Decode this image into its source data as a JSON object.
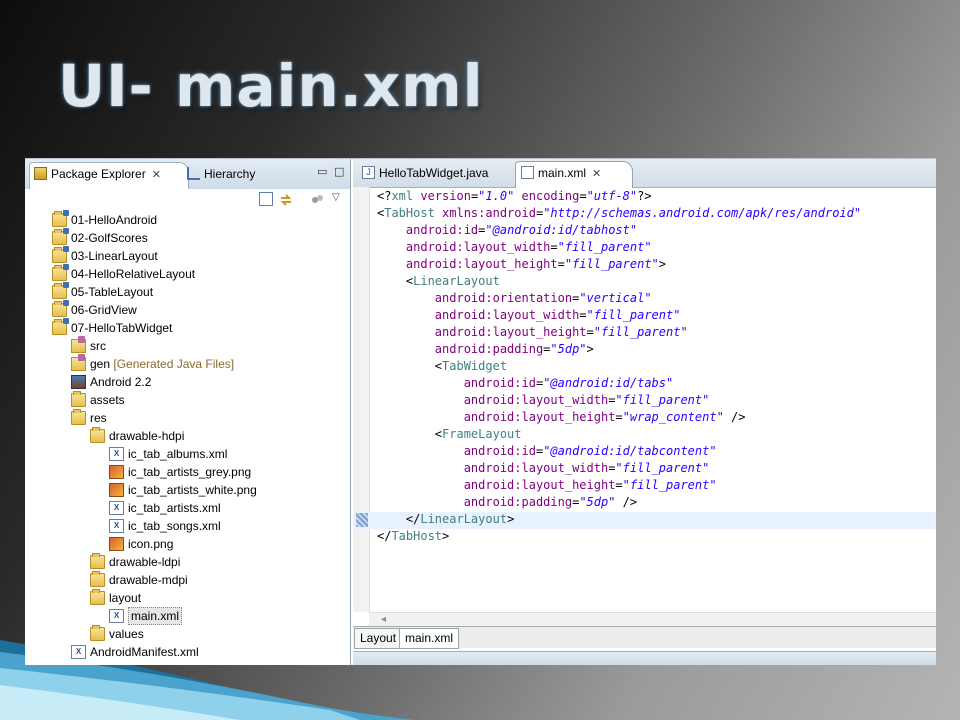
{
  "slide": {
    "title": "UI- main.xml"
  },
  "left_pane": {
    "tabs": [
      {
        "label": "Package Explorer",
        "icon": "package-explorer-icon"
      },
      {
        "label": "Hierarchy",
        "icon": "hierarchy-icon"
      }
    ],
    "close_glyph": "✕",
    "min_glyph": "▭",
    "max_glyph": "□"
  },
  "tree": [
    {
      "label": "01-HelloAndroid",
      "icon": "project-folder-icon",
      "depth": 1
    },
    {
      "label": "02-GolfScores",
      "icon": "project-folder-icon",
      "depth": 1
    },
    {
      "label": "03-LinearLayout",
      "icon": "project-folder-icon",
      "depth": 1
    },
    {
      "label": "04-HelloRelativeLayout",
      "icon": "project-folder-icon",
      "depth": 1
    },
    {
      "label": "05-TableLayout",
      "icon": "project-folder-icon",
      "depth": 1
    },
    {
      "label": "06-GridView",
      "icon": "project-folder-icon",
      "depth": 1
    },
    {
      "label": "07-HelloTabWidget",
      "icon": "project-folder-icon",
      "depth": 1
    },
    {
      "label": "src",
      "icon": "source-folder-icon",
      "depth": 2
    },
    {
      "label": "gen",
      "decoration": "[Generated Java Files]",
      "icon": "source-folder-icon",
      "depth": 2
    },
    {
      "label": "Android 2.2",
      "icon": "android-library-icon",
      "depth": 2
    },
    {
      "label": "assets",
      "icon": "folder-icon",
      "depth": 2
    },
    {
      "label": "res",
      "icon": "folder-icon",
      "depth": 2
    },
    {
      "label": "drawable-hdpi",
      "icon": "folder-icon",
      "depth": 3
    },
    {
      "label": "ic_tab_albums.xml",
      "icon": "xml-file-icon",
      "depth": 4
    },
    {
      "label": "ic_tab_artists_grey.png",
      "icon": "png-file-icon",
      "depth": 4
    },
    {
      "label": "ic_tab_artists_white.png",
      "icon": "png-file-icon",
      "depth": 4
    },
    {
      "label": "ic_tab_artists.xml",
      "icon": "xml-file-icon",
      "depth": 4
    },
    {
      "label": "ic_tab_songs.xml",
      "icon": "xml-file-icon",
      "depth": 4
    },
    {
      "label": "icon.png",
      "icon": "png-file-icon",
      "depth": 4
    },
    {
      "label": "drawable-ldpi",
      "icon": "folder-icon",
      "depth": 3
    },
    {
      "label": "drawable-mdpi",
      "icon": "folder-icon",
      "depth": 3
    },
    {
      "label": "layout",
      "icon": "folder-icon",
      "depth": 3
    },
    {
      "label": "main.xml",
      "icon": "xml-file-icon",
      "depth": 4,
      "selected": true
    },
    {
      "label": "values",
      "icon": "folder-icon",
      "depth": 3
    },
    {
      "label": "AndroidManifest.xml",
      "icon": "manifest-file-icon",
      "depth": 2
    }
  ],
  "editor": {
    "tabs": [
      {
        "label": "HelloTabWidget.java",
        "icon": "java-file-icon"
      },
      {
        "label": "main.xml",
        "icon": "xml-file-icon",
        "active": true
      }
    ],
    "close_glyph": "✕",
    "bottom_tabs": [
      "Layout",
      "main.xml"
    ],
    "lines": [
      [
        [
          "p",
          "<?"
        ],
        [
          "t",
          "xml"
        ],
        [
          "a",
          " version"
        ],
        [
          "p",
          "="
        ],
        [
          "v",
          "\"1.0\""
        ],
        [
          "a",
          " encoding"
        ],
        [
          "p",
          "="
        ],
        [
          "v",
          "\"utf-8\""
        ],
        [
          "p",
          "?>"
        ]
      ],
      [
        [
          "p",
          "<"
        ],
        [
          "t",
          "TabHost"
        ],
        [
          "a",
          " xmlns:android"
        ],
        [
          "p",
          "="
        ],
        [
          "v",
          "\"http://schemas.android.com/apk/res/android\""
        ]
      ],
      [
        [
          "a",
          "    android:id"
        ],
        [
          "p",
          "="
        ],
        [
          "v",
          "\"@android:id/tabhost\""
        ]
      ],
      [
        [
          "a",
          "    android:layout_width"
        ],
        [
          "p",
          "="
        ],
        [
          "v",
          "\"fill_parent\""
        ]
      ],
      [
        [
          "a",
          "    android:layout_height"
        ],
        [
          "p",
          "="
        ],
        [
          "v",
          "\"fill_parent\""
        ],
        [
          "p",
          ">"
        ]
      ],
      [
        [
          "p",
          "    <"
        ],
        [
          "t",
          "LinearLayout"
        ]
      ],
      [
        [
          "a",
          "        android:orientation"
        ],
        [
          "p",
          "="
        ],
        [
          "v",
          "\"vertical\""
        ]
      ],
      [
        [
          "a",
          "        android:layout_width"
        ],
        [
          "p",
          "="
        ],
        [
          "v",
          "\"fill_parent\""
        ]
      ],
      [
        [
          "a",
          "        android:layout_height"
        ],
        [
          "p",
          "="
        ],
        [
          "v",
          "\"fill_parent\""
        ]
      ],
      [
        [
          "a",
          "        android:padding"
        ],
        [
          "p",
          "="
        ],
        [
          "v",
          "\"5dp\""
        ],
        [
          "p",
          ">"
        ]
      ],
      [
        [
          "p",
          "        <"
        ],
        [
          "t",
          "TabWidget"
        ]
      ],
      [
        [
          "a",
          "            android:id"
        ],
        [
          "p",
          "="
        ],
        [
          "v",
          "\"@android:id/tabs\""
        ]
      ],
      [
        [
          "a",
          "            android:layout_width"
        ],
        [
          "p",
          "="
        ],
        [
          "v",
          "\"fill_parent\""
        ]
      ],
      [
        [
          "a",
          "            android:layout_height"
        ],
        [
          "p",
          "="
        ],
        [
          "v",
          "\"wrap_content\""
        ],
        [
          "p",
          " />"
        ]
      ],
      [
        [
          "p",
          "        <"
        ],
        [
          "t",
          "FrameLayout"
        ]
      ],
      [
        [
          "a",
          "            android:id"
        ],
        [
          "p",
          "="
        ],
        [
          "v",
          "\"@android:id/tabcontent\""
        ]
      ],
      [
        [
          "a",
          "            android:layout_width"
        ],
        [
          "p",
          "="
        ],
        [
          "v",
          "\"fill_parent\""
        ]
      ],
      [
        [
          "a",
          "            android:layout_height"
        ],
        [
          "p",
          "="
        ],
        [
          "v",
          "\"fill_parent\""
        ]
      ],
      [
        [
          "a",
          "            android:padding"
        ],
        [
          "p",
          "="
        ],
        [
          "v",
          "\"5dp\""
        ],
        [
          "p",
          " />"
        ]
      ],
      [
        [
          "p",
          "    </"
        ],
        [
          "t",
          "LinearLayout"
        ],
        [
          "p",
          ">"
        ]
      ],
      [
        [
          "p",
          "</"
        ],
        [
          "t",
          "TabHost"
        ],
        [
          "p",
          ">"
        ]
      ]
    ],
    "highlighted_line": 20
  },
  "colors": {
    "tag": "#3f7f7f",
    "attribute": "#7f007f",
    "value": "#2a00ff",
    "highlight": "#e8f2fe",
    "title": "#dfe7ee"
  }
}
